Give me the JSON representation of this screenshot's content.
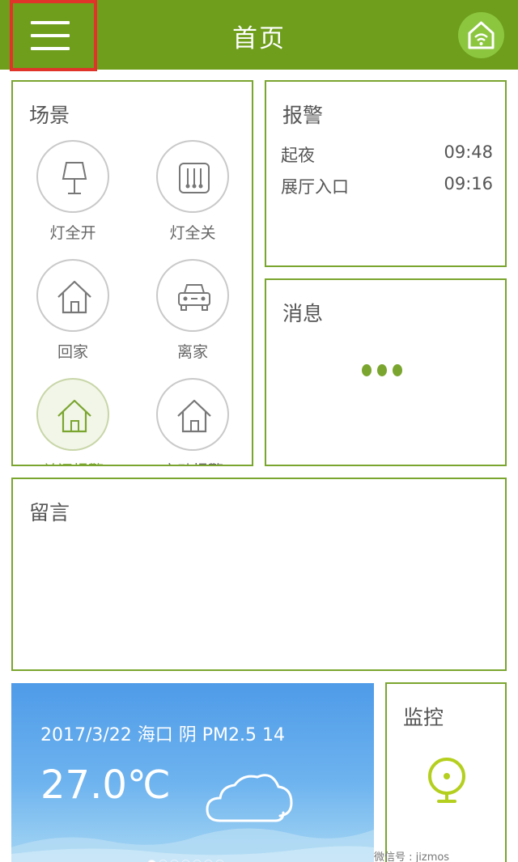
{
  "header": {
    "title": "首页",
    "menu_icon": "menu-icon",
    "right_icon": "home-wifi-icon",
    "accent": "#6e9e1c"
  },
  "scenes": {
    "title": "场景",
    "items": [
      {
        "label": "灯全开",
        "icon": "lamp-icon"
      },
      {
        "label": "灯全关",
        "icon": "light-switch-icon"
      },
      {
        "label": "回家",
        "icon": "home-icon"
      },
      {
        "label": "离家",
        "icon": "car-icon"
      },
      {
        "label": "关闭报警",
        "icon": "home-green-icon",
        "active": true
      },
      {
        "label": "启动报警",
        "icon": "home-icon"
      }
    ]
  },
  "alarm": {
    "title": "报警",
    "rows": [
      {
        "name": "起夜",
        "time": "09:48"
      },
      {
        "name": "展厅入口",
        "time": "09:16"
      }
    ]
  },
  "messages": {
    "title": "消息"
  },
  "notes": {
    "title": "留言"
  },
  "weather": {
    "info": "2017/3/22 海口 阴 PM2.5 14",
    "temp": "27.0℃",
    "pages": 7,
    "current_page": 0
  },
  "monitor": {
    "title": "监控"
  },
  "watermark": "微信号 : jizmos"
}
